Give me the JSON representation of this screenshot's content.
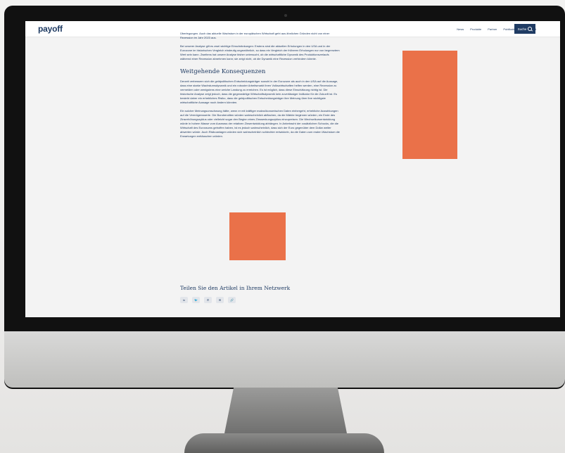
{
  "header": {
    "logo": "payoff",
    "nav": [
      "News",
      "Produkte",
      "Partner",
      "Publikationen",
      "Kontakt"
    ],
    "search_label": "Suche"
  },
  "article": {
    "intro_fragment": "Überlegungen. Auch das aktuelle Wachstum in der europäischen Wirtschaft geht aus ähnlichen Gründen nicht von einer Rezession im Jahr 2023 aus.",
    "paragraph_1": "Bei unserer Analyse gilt es zwei wichtige Einschränkungen: Erstens sind die aktuellen Erholungen in den USA und in der Eurozone im historischen Vergleich eindeutig ungewöhnlich, so dass ein Vergleich der früheren Erholungen nur von begrenztem Wert sein kann. Zweitens hat unsere Analyse bisher untersucht, ob die wirtschaftliche Dynamik des Produktionsverlaufs während einer Rezession abnehmen kann; sie zeigt nicht, ob die Dynamik eine Rezession verhindern könnte.",
    "heading": "Weitgehende Konsequenzen",
    "paragraph_2": "Derzeit verbessern sich die geldpolitischen Entscheidungsträger sowohl in der Eurozone als auch in den USA auf die Aussage, dass eine starke Wachstumsdynamik und ein robuster Arbeitsmarkt ihren Volkswirtschaften helfen werden, eine Rezession zu vermeiden oder wenigstens eine weiche Landung zu erreichen. Es ist möglich, dass diese Einschätzung richtig ist. Die historische Analyse zeigt jedoch, dass die gegenwärtige Wirtschaftsdynamik kein zuverlässiger Indikator für die Zukunft ist. Es besteht daher ein erhebliches Risiko, dass die geldpolitischen Entscheidungsträger ihre Meinung über ihre wichtigste wirtschaftliche Aussage noch ändern könnten.",
    "paragraph_3": "Ein solcher Meinungsumschwung hätte, wenn er mit kräftiger makroökonomischen Daten einhergeht, erhebliche Auswirkungen auf die Vermögenswerte. Die Bondrenditen würden wahrscheinlich abflachen, da die Märkte beginnen würden, ein Ende des Zinserhöhungszyklus oder vielleicht sogar den Beginn eines Zinssenkungszyklus einzupreisen. Die Wechselkursentwicklung würde in hohem Masse vom Ausmass der relativen Zinsentwicklung abhängen. In Anbetracht der zusätzlichen Schocks, die die Wirtschaft des Euroraums getroffen haben, ist es jedoch wahrscheinlich, dass sich der Euro gegenüber dem Dollar weiter abwerten würde. Auch Risikoanlagen würden sich wahrscheinlich schlechter entwickeln, da die Daten zum realen Wachstum die Erwartungen enttäuschen würden."
  },
  "share": {
    "title": "Teilen Sie den Artikel in Ihrem Netzwerk",
    "buttons": [
      {
        "icon": "linkedin-icon",
        "glyph": "in"
      },
      {
        "icon": "twitter-icon",
        "glyph": "🐦"
      },
      {
        "icon": "whatsapp-icon",
        "glyph": "✆"
      },
      {
        "icon": "email-icon",
        "glyph": "✉"
      },
      {
        "icon": "link-icon",
        "glyph": "🔗"
      }
    ]
  },
  "colors": {
    "brand_navy": "#1f3b63",
    "accent_orange": "#ea7149"
  }
}
